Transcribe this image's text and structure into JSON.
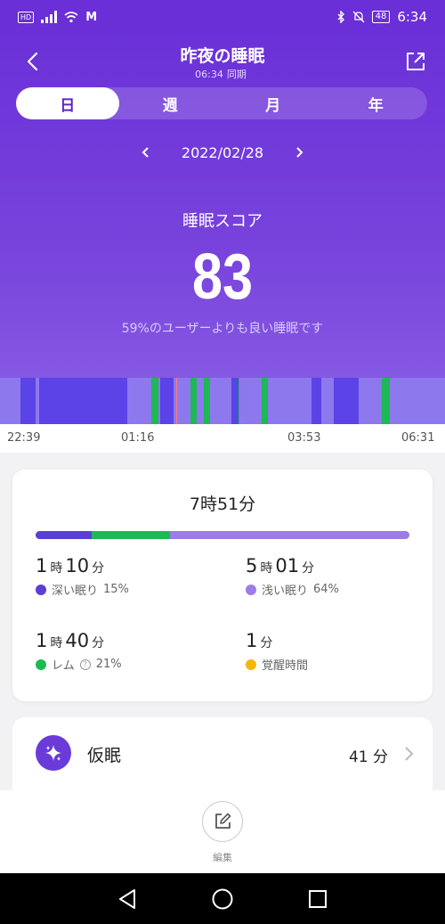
{
  "status_bar": {
    "hd": "HD",
    "carrier_icon": "M",
    "battery": "48",
    "time": "6:34"
  },
  "header": {
    "title": "昨夜の睡眠",
    "sync_time": "06:34",
    "sync_label": "同期"
  },
  "tabs": [
    {
      "label": "日",
      "active": true
    },
    {
      "label": "週",
      "active": false
    },
    {
      "label": "月",
      "active": false
    },
    {
      "label": "年",
      "active": false
    }
  ],
  "date": "2022/02/28",
  "score": {
    "label": "睡眠スコア",
    "value": "83",
    "description": "59%のユーザーよりも良い睡眠です"
  },
  "timeline": {
    "ticks": [
      "22:39",
      "01:16",
      "03:53",
      "06:31"
    ]
  },
  "hypnogram": {
    "stage_colors": {
      "deep": "#5b43e8",
      "light": "#8d78ee",
      "rem": "#1db954",
      "awake": "#f5b700"
    },
    "note": "segments as start/end fraction of night",
    "segments": [
      {
        "stage": "deep",
        "from": 0.045,
        "to": 0.08
      },
      {
        "stage": "deep",
        "from": 0.088,
        "to": 0.285
      },
      {
        "stage": "rem",
        "from": 0.135,
        "to": 0.15
      },
      {
        "stage": "rem",
        "from": 0.165,
        "to": 0.178
      },
      {
        "stage": "rem",
        "from": 0.192,
        "to": 0.21
      },
      {
        "stage": "rem",
        "from": 0.222,
        "to": 0.232
      },
      {
        "stage": "rem",
        "from": 0.237,
        "to": 0.278
      },
      {
        "stage": "rem",
        "from": 0.34,
        "to": 0.356
      },
      {
        "stage": "deep",
        "from": 0.36,
        "to": 0.39
      },
      {
        "stage": "rem",
        "from": 0.428,
        "to": 0.442
      },
      {
        "stage": "rem",
        "from": 0.458,
        "to": 0.472
      },
      {
        "stage": "deep",
        "from": 0.52,
        "to": 0.536
      },
      {
        "stage": "rem",
        "from": 0.522,
        "to": 0.538
      },
      {
        "stage": "rem",
        "from": 0.588,
        "to": 0.602
      },
      {
        "stage": "deep",
        "from": 0.7,
        "to": 0.722
      },
      {
        "stage": "rem",
        "from": 0.703,
        "to": 0.72
      },
      {
        "stage": "deep",
        "from": 0.75,
        "to": 0.805
      },
      {
        "stage": "rem",
        "from": 0.858,
        "to": 0.876
      }
    ]
  },
  "summary": {
    "total": "7時51分",
    "bar": {
      "deep": 15,
      "rem": 21,
      "light": 64
    },
    "stats": [
      {
        "key": "deep",
        "hours": "1",
        "hour_unit": "時",
        "minutes": "10",
        "minute_unit": "分",
        "label": "深い眠り",
        "percent": "15%",
        "color": "#5b3fd4"
      },
      {
        "key": "light",
        "hours": "5",
        "hour_unit": "時",
        "minutes": "01",
        "minute_unit": "分",
        "label": "浅い眠り",
        "percent": "64%",
        "color": "#9c7de8"
      },
      {
        "key": "rem",
        "hours": "1",
        "hour_unit": "時",
        "minutes": "40",
        "minute_unit": "分",
        "label": "レム",
        "percent": "21%",
        "color": "#1db954"
      },
      {
        "key": "awake",
        "value": "1",
        "unit": "分",
        "label": "覚醒時間",
        "color": "#f5b700"
      }
    ]
  },
  "nap": {
    "title": "仮眠",
    "value": "41 分"
  },
  "edit": {
    "label": "編集"
  }
}
